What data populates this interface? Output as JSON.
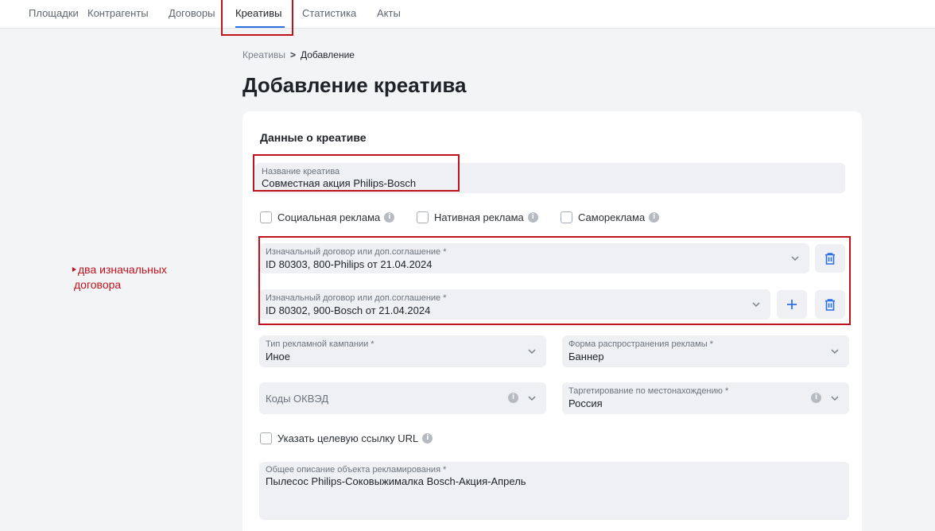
{
  "nav": {
    "items": [
      {
        "label": "Площадки"
      },
      {
        "label": "Контрагенты"
      },
      {
        "label": "Договоры"
      },
      {
        "label": "Креативы"
      },
      {
        "label": "Статистика"
      },
      {
        "label": "Акты"
      }
    ],
    "active": "Креативы"
  },
  "annotation": {
    "line1": "два изначальных",
    "line2": "договора"
  },
  "breadcrumb": {
    "parent": "Креативы",
    "separator": ">",
    "current": "Добавление"
  },
  "page_title": "Добавление креатива",
  "form": {
    "section_title": "Данные о креативе",
    "creative_name": {
      "label": "Название креатива",
      "value": "Совместная акция Philips-Bosch"
    },
    "checkboxes": [
      {
        "label": "Социальная реклама",
        "checked": false
      },
      {
        "label": "Нативная реклама",
        "checked": false
      },
      {
        "label": "Самореклама",
        "checked": false
      }
    ],
    "contracts": [
      {
        "label": "Изначальный договор или доп.соглашение *",
        "value": "ID 80303, 800-Philips от 21.04.2024"
      },
      {
        "label": "Изначальный договор или доп.соглашение *",
        "value": "ID 80302, 900-Bosch от 21.04.2024"
      }
    ],
    "campaign_type": {
      "label": "Тип рекламной кампании *",
      "value": "Иное"
    },
    "distribution_form": {
      "label": "Форма распространения рекламы *",
      "value": "Баннер"
    },
    "okved": {
      "placeholder": "Коды ОКВЭД"
    },
    "geo_targeting": {
      "label": "Таргетирование по местонахождению *",
      "value": "Россия"
    },
    "target_url_checkbox": {
      "label": "Указать целевую ссылку URL",
      "checked": false
    },
    "description": {
      "label": "Общее описание объекта рекламирования *",
      "value": "Пылесос Philips-Соковыжималка Bosch-Акция-Апрель"
    }
  },
  "colors": {
    "accent": "#2f6fe4",
    "annotation_red": "#c0121c",
    "field_bg": "#eef0f3",
    "page_bg": "#f3f4f6"
  },
  "icons": [
    "info-icon",
    "chevron-down-icon",
    "trash-icon",
    "plus-icon",
    "checkbox-icon"
  ]
}
